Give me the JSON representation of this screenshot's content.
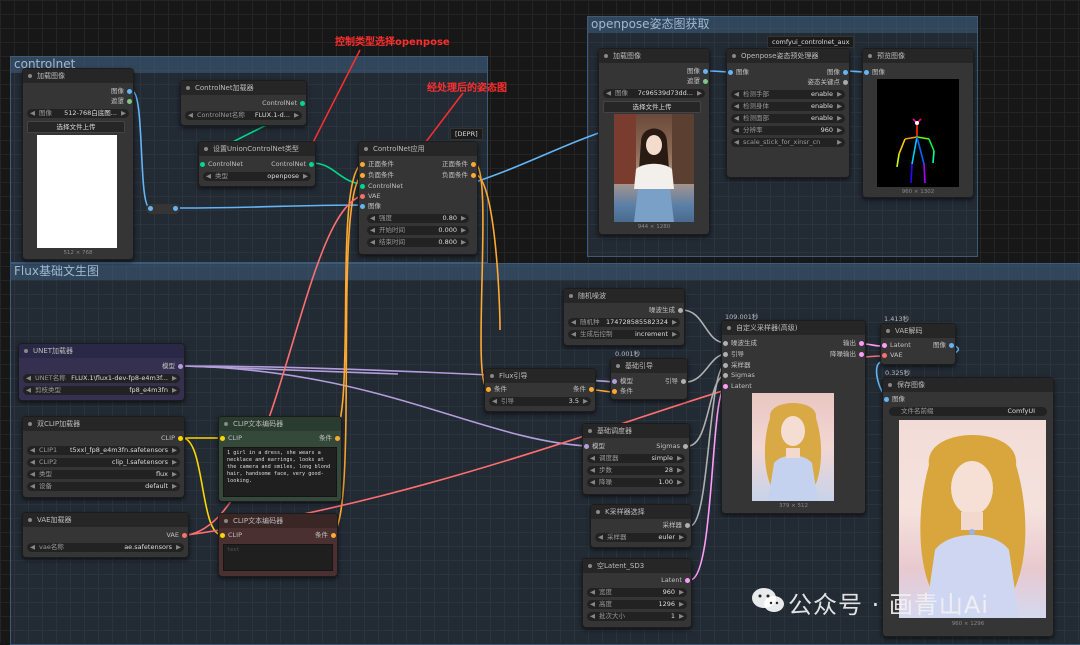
{
  "groups": {
    "controlnet": "controlnet",
    "openpose": "openpose姿态图获取",
    "flux": "Flux基础文生图"
  },
  "annotations": {
    "select_openpose": "控制类型选择openpose",
    "processed_pose": "经处理后的姿态图"
  },
  "nodes": {
    "load_image_cn": {
      "title": "加载图像",
      "out_image": "图像",
      "out_mask": "遮罩",
      "image_label": "图像",
      "image_value": "512-768白底图...",
      "upload": "选择文件上传",
      "caption": "512 × 768"
    },
    "cn_loader": {
      "title": "ControlNet加载器",
      "out": "ControlNet",
      "name_label": "ControlNet名称",
      "name_value": "FLUX.1-d..."
    },
    "union_type": {
      "title": "设置UnionControlNet类型",
      "in": "ControlNet",
      "out": "ControlNet",
      "type_label": "类型",
      "type_value": "openpose"
    },
    "cn_apply": {
      "title": "ControlNet应用",
      "badge": "[DEPR]",
      "in_pos": "正面条件",
      "in_neg": "负面条件",
      "in_cn": "ControlNet",
      "in_vae": "VAE",
      "in_image": "图像",
      "out_pos": "正面条件",
      "out_neg": "负面条件",
      "strength_label": "强度",
      "strength_value": "0.80",
      "start_label": "开始时间",
      "start_value": "0.000",
      "end_label": "结束时间",
      "end_value": "0.800"
    },
    "load_image_op": {
      "title": "加载图像",
      "out_image": "图像",
      "out_mask": "遮罩",
      "image_label": "图像",
      "image_value": "7c96539d73dd...",
      "upload": "选择文件上传",
      "caption": "944 × 1280"
    },
    "openpose": {
      "title": "Openpose姿态预处理器",
      "badge": "comfyui_controlnet_aux",
      "in_image": "图像",
      "out_image": "图像",
      "out_kp": "姿态关键点",
      "hand_label": "检测手部",
      "hand_value": "enable",
      "body_label": "检测身体",
      "body_value": "enable",
      "face_label": "检测面部",
      "face_value": "enable",
      "res_label": "分辨率",
      "res_value": "960",
      "scale_value": "scale_stick_for_xinsr_cn"
    },
    "preview": {
      "title": "预览图像",
      "in_image": "图像",
      "caption": "960 × 1302"
    },
    "unet": {
      "title": "UNET加载器",
      "out": "模型",
      "name_label": "UNET名称",
      "name_value": "FLUX.1\\flux1-dev-fp8-e4m3f...",
      "dtype_label": "剪枝类型",
      "dtype_value": "fp8_e4m3fn"
    },
    "dual_clip": {
      "title": "双CLIP加载器",
      "out": "CLIP",
      "clip1_label": "CLIP1",
      "clip1_value": "t5xxl_fp8_e4m3fn.safetensors",
      "clip2_label": "CLIP2",
      "clip2_value": "clip_l.safetensors",
      "type_label": "类型",
      "type_value": "flux",
      "device_label": "设备",
      "device_value": "default"
    },
    "vae_loader": {
      "title": "VAE加载器",
      "out": "VAE",
      "name_label": "vae名称",
      "name_value": "ae.safetensors"
    },
    "clip_pos": {
      "title": "CLIP文本编码器",
      "in": "CLIP",
      "out": "条件",
      "text": "1 girl in a dress, she wears a necklace and earrings, looks at the camera and smiles, long blond hair, handsome face, very good-looking."
    },
    "clip_neg": {
      "title": "CLIP文本编码器",
      "in": "CLIP",
      "out": "条件",
      "text": "text"
    },
    "flux_guide": {
      "title": "Flux引导",
      "in": "条件",
      "out": "条件",
      "guide_label": "引导",
      "guide_value": "3.5"
    },
    "noise": {
      "title": "随机噪波",
      "out": "噪波生成",
      "seed_label": "随机种",
      "seed_value": "174728585582324",
      "ctrl_label": "生成后控制",
      "ctrl_value": "increment"
    },
    "basic_guider": {
      "title": "基础引导",
      "time": "0.001秒",
      "in_model": "模型",
      "in_cond": "条件",
      "out": "引导"
    },
    "scheduler": {
      "title": "基础调度器",
      "in_model": "模型",
      "out": "Sigmas",
      "sched_label": "调度器",
      "sched_value": "simple",
      "steps_label": "步数",
      "steps_value": "28",
      "denoise_label": "降噪",
      "denoise_value": "1.00"
    },
    "ksampler_select": {
      "title": "K采样器选择",
      "out": "采样器",
      "name_label": "采样器",
      "name_value": "euler"
    },
    "empty_latent": {
      "title": "空Latent_SD3",
      "out": "Latent",
      "w_label": "宽度",
      "w_value": "960",
      "h_label": "高度",
      "h_value": "1296",
      "b_label": "批次大小",
      "b_value": "1"
    },
    "adv_sampler": {
      "title": "自定义采样器(高级)",
      "time": "109.001秒",
      "in_noise": "噪波生成",
      "in_guider": "引导",
      "in_sampler": "采样器",
      "in_sigmas": "Sigmas",
      "in_latent": "Latent",
      "out1": "输出",
      "out2": "降噪输出",
      "caption": "379 × 512"
    },
    "vae_decode": {
      "title": "VAE解码",
      "time": "1.413秒",
      "in_latent": "Latent",
      "in_vae": "VAE",
      "out": "图像"
    },
    "save": {
      "title": "保存图像",
      "time": "0.325秒",
      "in_image": "图像",
      "prefix_label": "文件名前缀",
      "prefix_value": "ComfyUI",
      "caption": "960 × 1296"
    }
  },
  "watermark": {
    "text": "公众号 · 画青山Ai"
  },
  "colors": {
    "wire_model": "#b39ddb",
    "wire_clip": "#ffd500",
    "wire_cond": "#ffa931",
    "wire_vae": "#ff6e6e",
    "wire_image": "#64b5f6",
    "wire_latent": "#ff9cf9",
    "wire_cn": "#00d78d",
    "wire_noise": "#b0b0b0",
    "annotation": "#ff2e2e"
  }
}
